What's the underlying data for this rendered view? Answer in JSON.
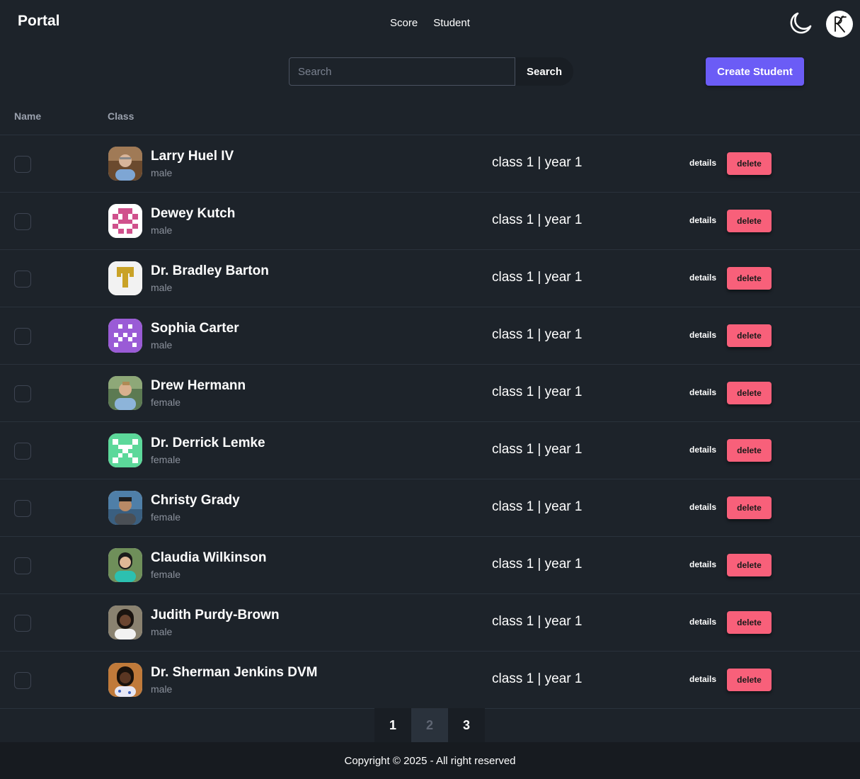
{
  "navbar": {
    "brand": "Portal",
    "links": [
      "Score",
      "Student"
    ],
    "theme_icon": "moon-icon",
    "profile_icon": "profile-monogram-icon"
  },
  "search": {
    "placeholder": "Search",
    "value": "",
    "button_label": "Search"
  },
  "create_button_label": "Create Student",
  "table": {
    "headers": {
      "name": "Name",
      "class": "Class"
    },
    "actions": {
      "details": "details",
      "delete": "delete"
    },
    "rows": [
      {
        "name": "Larry Huel IV",
        "gender": "male",
        "class": "class 1 | year 1",
        "avatar": "photo"
      },
      {
        "name": "Dewey Kutch",
        "gender": "male",
        "class": "class 1 | year 1",
        "avatar": "identicon-pink"
      },
      {
        "name": "Dr. Bradley Barton",
        "gender": "male",
        "class": "class 1 | year 1",
        "avatar": "identicon-gold"
      },
      {
        "name": "Sophia Carter",
        "gender": "male",
        "class": "class 1 | year 1",
        "avatar": "identicon-purple"
      },
      {
        "name": "Drew Hermann",
        "gender": "female",
        "class": "class 1 | year 1",
        "avatar": "photo"
      },
      {
        "name": "Dr. Derrick Lemke",
        "gender": "female",
        "class": "class 1 | year 1",
        "avatar": "identicon-green"
      },
      {
        "name": "Christy Grady",
        "gender": "female",
        "class": "class 1 | year 1",
        "avatar": "photo"
      },
      {
        "name": "Claudia Wilkinson",
        "gender": "female",
        "class": "class 1 | year 1",
        "avatar": "photo"
      },
      {
        "name": "Judith Purdy-Brown",
        "gender": "male",
        "class": "class 1 | year 1",
        "avatar": "photo"
      },
      {
        "name": "Dr. Sherman Jenkins DVM",
        "gender": "male",
        "class": "class 1 | year 1",
        "avatar": "photo"
      }
    ]
  },
  "pagination": {
    "pages": [
      "1",
      "2",
      "3"
    ],
    "current": "2"
  },
  "footer": {
    "text": "Copyright © 2025 - All right reserved"
  },
  "colors": {
    "background": "#1d232a",
    "primary": "#6b5cf6",
    "error": "#f8607a",
    "identicon_pink": "#d0508c",
    "identicon_gold": "#c9a227",
    "identicon_purple": "#9a5bd6",
    "identicon_green": "#5cd89a"
  }
}
